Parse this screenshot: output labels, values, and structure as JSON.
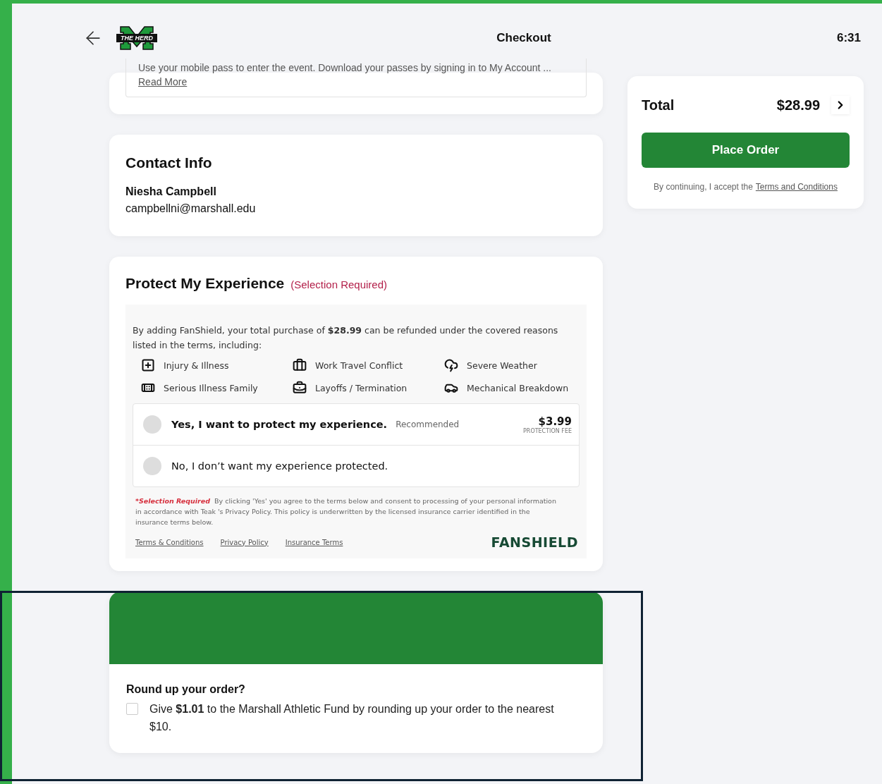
{
  "header": {
    "title": "Checkout",
    "logo_text": "THE HERD",
    "time": "6:31"
  },
  "event_info": {
    "text": "Use your mobile pass to enter the event. Download your passes by signing in to My Account ...",
    "link": "Read More"
  },
  "contact": {
    "title": "Contact Info",
    "name": "Niesha Campbell",
    "email": "campbellni@marshall.edu"
  },
  "protect": {
    "title": "Protect My Experience",
    "required_note": "(Selection Required)",
    "intro": "By adding FanShield, your total purchase of **$28.99** can be refunded under the covered reasons listed in the terms, including:",
    "reasons": [
      "Injury & Illness",
      "Work Travel Conflict",
      "Severe Weather",
      "Serious Illness Family",
      "Layoffs / Termination",
      "Mechanical Breakdown"
    ],
    "options": [
      {
        "label": "Yes, I want to protect my experience.",
        "tag": "Recommended",
        "price": "$3.99",
        "price_note": "PROTECTION FEE",
        "selected": false
      },
      {
        "label": "No, I don’t want my experience protected.",
        "selected": false
      }
    ],
    "disclaimer_lead": "*Selection Required",
    "disclaimer": "By clicking 'Yes' you agree to the terms below and consent to processing of your personal information in accordance with Teak 's Privacy Policy. This policy is underwritten by the licensed insurance carrier identified in the insurance terms below.",
    "links": [
      "Terms & Conditions",
      "Privacy Policy",
      "Insurance Terms"
    ],
    "brand": "FANSHIELD"
  },
  "round_up": {
    "title": "Round up your order?",
    "text": "Give **$1.01** to the Marshall Athletic Fund by rounding up your order to the nearest $10.",
    "checked": false
  },
  "summary": {
    "total_label": "Total",
    "total": "$28.99",
    "button": "Place Order",
    "terms_prefix": "By continuing, I accept the",
    "terms_link": "Terms and Conditions"
  }
}
